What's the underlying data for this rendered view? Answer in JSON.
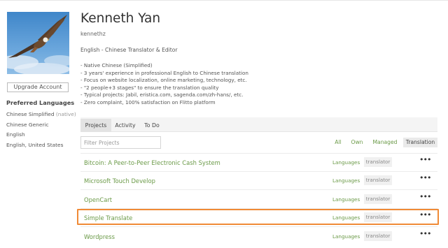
{
  "profile": {
    "name": "Kenneth Yan",
    "username": "kennethz",
    "headline": "English - Chinese Translator & Editor",
    "bio": [
      "- Native Chinese (Simplified)",
      "- 3 years' experience in professional English to Chinese translation",
      "- Focus on website localization, online marketing, technology, etc.",
      "- \"2 people+3 stages\" to ensure the translation quality",
      "- Typical projects: Jabil, eristica.com, sagenda.com/zh-hans/, etc.",
      "- Zero complaint, 100% satisfaction on Flitto platform"
    ]
  },
  "sidebar": {
    "upgrade_label": "Upgrade Account",
    "preferred_title": "Preferred Languages",
    "languages": [
      {
        "label": "Chinese Simplified",
        "note": "(native)"
      },
      {
        "label": "Chinese Generic",
        "note": ""
      },
      {
        "label": "English",
        "note": ""
      },
      {
        "label": "English, United States",
        "note": ""
      }
    ]
  },
  "tabs": [
    {
      "label": "Projects",
      "active": true
    },
    {
      "label": "Activity",
      "active": false
    },
    {
      "label": "To Do",
      "active": false
    }
  ],
  "filter": {
    "placeholder": "Filter Projects",
    "buttons": [
      "All",
      "Own",
      "Managed",
      "Translation"
    ],
    "selected": "Translation"
  },
  "projects": [
    {
      "name": "Bitcoin: A Peer-to-Peer Electronic Cash System",
      "languages_label": "Languages",
      "role": "translator",
      "more": "•••"
    },
    {
      "name": "Microsoft Touch Develop",
      "languages_label": "Languages",
      "role": "translator",
      "more": "•••"
    },
    {
      "name": "OpenCart",
      "languages_label": "Languages",
      "role": "translator",
      "more": "•••"
    },
    {
      "name": "Simple Translate",
      "languages_label": "Languages",
      "role": "translator",
      "more": "•••",
      "highlighted": true
    },
    {
      "name": "Wordpress",
      "languages_label": "Languages",
      "role": "translator",
      "more": "•••"
    }
  ],
  "colors": {
    "link_green": "#6b9a48",
    "highlight_orange": "#f08a36"
  }
}
